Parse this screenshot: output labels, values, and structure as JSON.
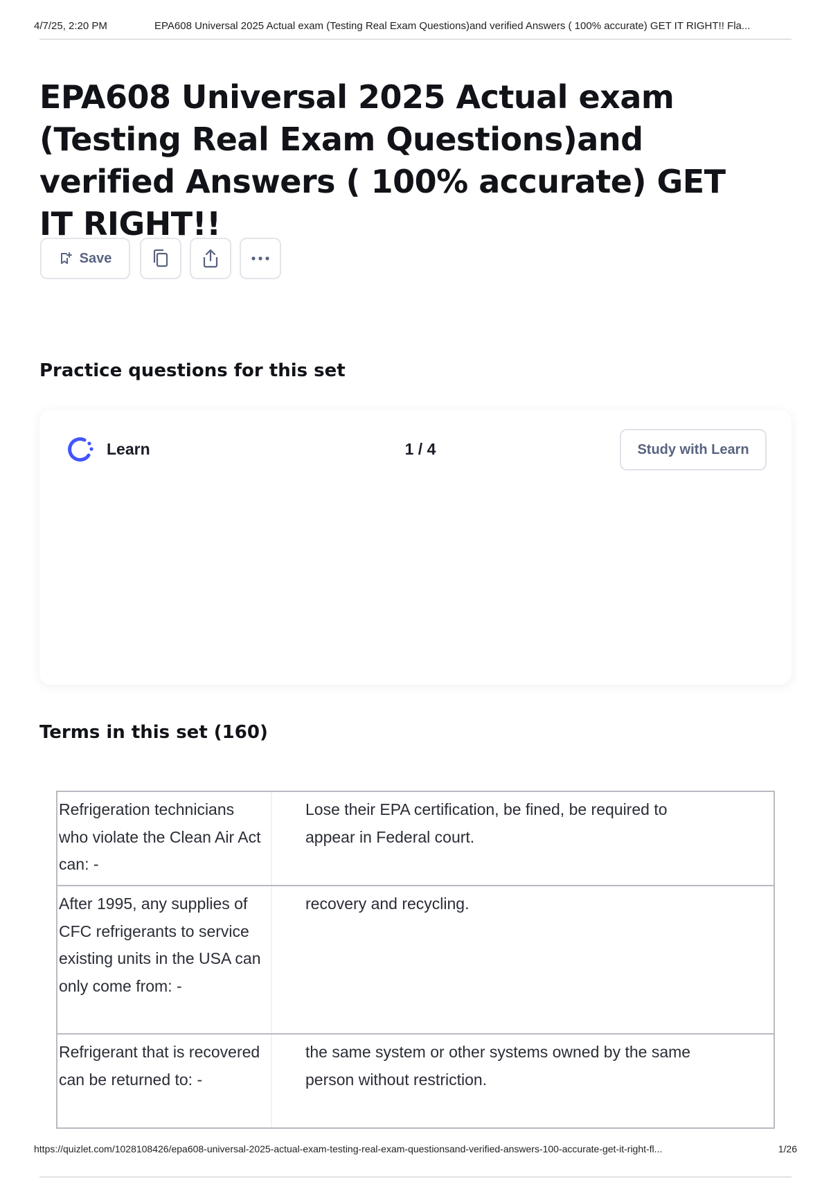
{
  "print_header": {
    "date": "4/7/25, 2:20 PM",
    "title": "EPA608 Universal 2025 Actual exam (Testing Real Exam Questions)and verified Answers ( 100% accurate) GET IT RIGHT!! Fla..."
  },
  "page": {
    "title": "EPA608 Universal 2025 Actual exam (Testing Real Exam Questions)and verified Answers ( 100% accurate) GET IT RIGHT!!"
  },
  "toolbar": {
    "save_label": "Save",
    "icons": [
      "bookmark-plus-icon",
      "copy-icon",
      "share-icon",
      "more-icon"
    ]
  },
  "practice": {
    "heading": "Practice questions for this set",
    "mode_label": "Learn",
    "progress": "1 / 4",
    "study_button_label": "Study with Learn"
  },
  "terms": {
    "heading": "Terms in this set (160)",
    "rows": [
      {
        "term": "Refrigeration technicians who violate the Clean Air Act can: -",
        "definition": "Lose their EPA certification, be fined, be required to appear in Federal court."
      },
      {
        "term": "After 1995, any supplies of CFC refrigerants to service existing units in the USA can only come from: -",
        "definition": "recovery and recycling."
      },
      {
        "term": "Refrigerant that is recovered can be returned to: -",
        "definition": "the same system or other systems owned by the same person without restriction."
      }
    ]
  },
  "print_footer": {
    "url": "https://quizlet.com/1028108426/epa608-universal-2025-actual-exam-testing-real-exam-questionsand-verified-answers-100-accurate-get-it-right-fl...",
    "page": "1/26"
  },
  "colors": {
    "accent": "#4255ff",
    "muted_text": "#586380",
    "border": "#e3e5ea"
  }
}
